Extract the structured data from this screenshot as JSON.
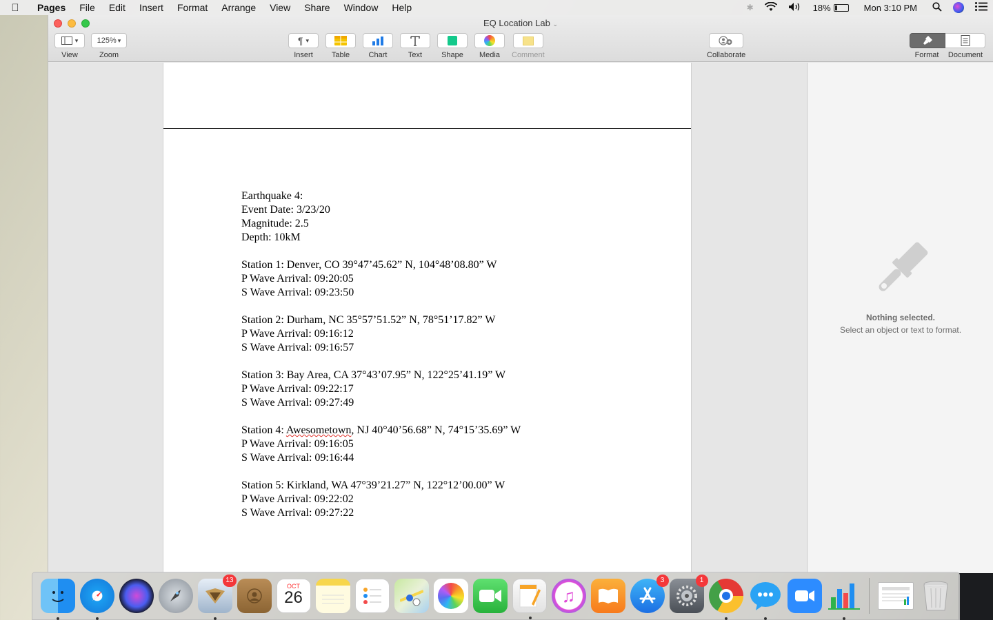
{
  "menubar": {
    "app_name": "Pages",
    "items": [
      "File",
      "Edit",
      "Insert",
      "Format",
      "Arrange",
      "View",
      "Share",
      "Window",
      "Help"
    ],
    "battery": "18%",
    "battery_level": 0.18,
    "clock": "Mon 3:10 PM"
  },
  "window": {
    "title": "EQ Location Lab",
    "toolbar": {
      "view_label": "View",
      "zoom_value": "125%",
      "zoom_label": "Zoom",
      "insert_label": "Insert",
      "table_label": "Table",
      "chart_label": "Chart",
      "text_label": "Text",
      "shape_label": "Shape",
      "media_label": "Media",
      "comment_label": "Comment",
      "collaborate_label": "Collaborate",
      "format_label": "Format",
      "document_label": "Document"
    }
  },
  "document": {
    "lines": [
      "Earthquake 4:",
      "Event Date: 3/23/20",
      "Magnitude: 2.5",
      "Depth: 10kM",
      "",
      "Station 1: Denver, CO 39°47’45.62” N, 104°48’08.80” W",
      "P Wave Arrival: 09:20:05",
      "S Wave Arrival: 09:23:50",
      "",
      "Station 2: Durham, NC 35°57’51.52” N, 78°51’17.82” W",
      "P Wave Arrival: 09:16:12",
      "S Wave Arrival: 09:16:57",
      "",
      "Station 3: Bay Area, CA 37°43’07.95” N, 122°25’41.19” W",
      "P Wave Arrival: 09:22:17",
      "S Wave Arrival: 09:27:49",
      "",
      "Station 4: ",
      "P Wave Arrival: 09:16:05",
      "S Wave Arrival: 09:16:44",
      "",
      "Station 5: Kirkland, WA 47°39’21.27” N, 122°12’00.00” W",
      "P Wave Arrival: 09:22:02",
      "S Wave Arrival: 09:27:22"
    ],
    "station4": {
      "prefix": "Station 4: ",
      "misspelled": "Awesometown",
      "suffix": ", NJ 40°40’56.68” N, 74°15’35.69” W"
    }
  },
  "inspector": {
    "title": "Nothing selected.",
    "subtitle": "Select an object or text to format."
  },
  "dock": {
    "calendar_month": "OCT",
    "calendar_day": "26",
    "badges": {
      "mail": "13",
      "app_store": "3",
      "system_prefs": "1"
    }
  },
  "colors": {
    "traffic_close": "#fc605c",
    "traffic_min": "#fdbc40",
    "traffic_max": "#34c84a",
    "spellcheck": "#e0312b"
  }
}
